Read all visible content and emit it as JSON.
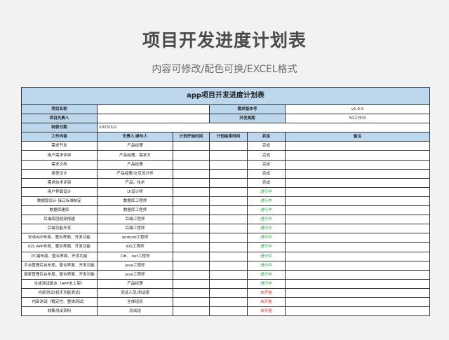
{
  "page": {
    "title": "项目开发进度计划表",
    "subtitle": "内容可修改/配色可换/EXCEL格式"
  },
  "sheet": {
    "title": "app项目开发进度计划表",
    "info": {
      "project_name_label": "项目名称",
      "project_name_value": "",
      "version_label": "需求版本号",
      "version_value": "v1.0.0",
      "owner_label": "项目负责人",
      "owner_value": "",
      "cycle_label": "开发周期",
      "cycle_value": "50工作日",
      "date_label": "制表日期",
      "date_value": "2023/3/2"
    },
    "headers": [
      "工作内容",
      "负责人/参与人",
      "计划开始时间",
      "计划结束时间",
      "状态",
      "备注"
    ],
    "rows": [
      {
        "task": "需求开发",
        "owner": "产品经理",
        "start": "",
        "end": "",
        "status": "完成",
        "status_type": "done",
        "note": ""
      },
      {
        "task": "用户需求评审",
        "owner": "产品经理，需求方",
        "start": "",
        "end": "",
        "status": "完成",
        "status_type": "done",
        "note": ""
      },
      {
        "task": "需求文档",
        "owner": "产品经理",
        "start": "",
        "end": "",
        "status": "完成",
        "status_type": "done",
        "note": ""
      },
      {
        "task": "原型设计",
        "owner": "产品经理/交互设计师",
        "start": "",
        "end": "",
        "status": "完成",
        "status_type": "done",
        "note": ""
      },
      {
        "task": "需求技术评审",
        "owner": "产品，技术",
        "start": "",
        "end": "",
        "status": "完成",
        "status_type": "done",
        "note": ""
      },
      {
        "task": "用户界面设计",
        "owner": "UI设计师",
        "start": "",
        "end": "",
        "status": "进行中",
        "status_type": "progress",
        "note": ""
      },
      {
        "task": "数据库设计 接口标准制定",
        "owner": "数据库工程师",
        "start": "",
        "end": "",
        "status": "进行中",
        "status_type": "progress",
        "note": ""
      },
      {
        "task": "数据库建库",
        "owner": "数据库工程师",
        "start": "",
        "end": "",
        "status": "进行中",
        "status_type": "progress",
        "note": ""
      },
      {
        "task": "后端底层框架搭建",
        "owner": "后端工程师",
        "start": "",
        "end": "",
        "status": "进行中",
        "status_type": "progress",
        "note": ""
      },
      {
        "task": "后端功能开发",
        "owner": "后端工程师",
        "start": "",
        "end": "",
        "status": "进行中",
        "status_type": "progress",
        "note": ""
      },
      {
        "task": "安卓APP布局、整合界面、开发功能",
        "owner": "android工程师",
        "start": "",
        "end": "",
        "status": "进行中",
        "status_type": "progress",
        "note": ""
      },
      {
        "task": "IOS APP布局、整合界面、开发功能",
        "owner": "iOS工程师",
        "start": "",
        "end": "",
        "status": "进行中",
        "status_type": "progress",
        "note": ""
      },
      {
        "task": "PC端布局、整合界面、开发功能",
        "owner": "C#、.net工程师",
        "start": "",
        "end": "",
        "status": "进行中",
        "status_type": "progress",
        "note": ""
      },
      {
        "task": "平台管理后台布局、整合界面、开发功能",
        "owner": "java工程师",
        "start": "",
        "end": "",
        "status": "进行中",
        "status_type": "progress",
        "note": ""
      },
      {
        "task": "商家管理后台布局、整合界面、开发功能",
        "owner": "java工程师",
        "start": "",
        "end": "",
        "status": "进行中",
        "status_type": "progress",
        "note": ""
      },
      {
        "task": "生成测试版本（APP未上架）",
        "owner": "产品经理",
        "start": "",
        "end": "",
        "status": "进行中",
        "status_type": "progress",
        "note": ""
      },
      {
        "task": "内部测试(初步功能测试)",
        "owner": "测试人员/测试组",
        "start": "",
        "end": "",
        "status": "未开始",
        "status_type": "not",
        "note": ""
      },
      {
        "task": "内部测试（稳定性、整体测试）",
        "owner": "全体组员",
        "start": "",
        "end": "",
        "status": "未开始",
        "status_type": "not",
        "note": ""
      },
      {
        "task": "收集测试资料",
        "owner": "测试组",
        "start": "",
        "end": "",
        "status": "未开始",
        "status_type": "not",
        "note": ""
      }
    ]
  }
}
